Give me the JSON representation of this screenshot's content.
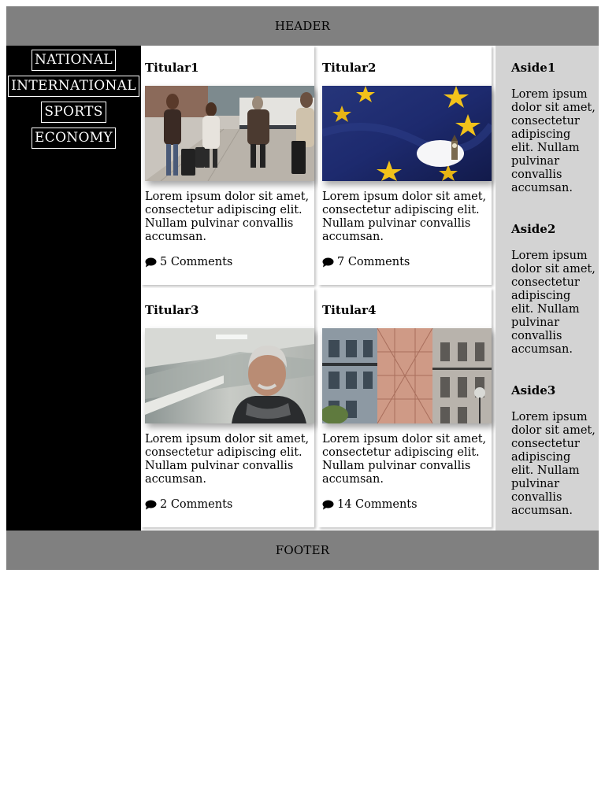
{
  "header": {
    "label": "HEADER"
  },
  "footer": {
    "label": "FOOTER"
  },
  "nav": {
    "items": [
      {
        "label": "NATIONAL"
      },
      {
        "label": "INTERNATIONAL"
      },
      {
        "label": "SPORTS"
      },
      {
        "label": "ECONOMY"
      }
    ]
  },
  "articles": [
    {
      "title": "Titular1",
      "text": "Lorem ipsum dolor sit amet, consectetur adipiscing elit. Nullam pulvinar convallis accumsan.",
      "comments": "5 Comments"
    },
    {
      "title": "Titular2",
      "text": "Lorem ipsum dolor sit amet, consectetur adipiscing elit. Nullam pulvinar convallis accumsan.",
      "comments": "7 Comments"
    },
    {
      "title": "Titular3",
      "text": "Lorem ipsum dolor sit amet, consectetur adipiscing elit. Nullam pulvinar convallis accumsan.",
      "comments": "2 Comments"
    },
    {
      "title": "Titular4",
      "text": "Lorem ipsum dolor sit amet, consectetur adipiscing elit. Nullam pulvinar convallis accumsan.",
      "comments": "14 Comments"
    }
  ],
  "aside": [
    {
      "title": "Aside1",
      "text": "Lorem ipsum dolor sit amet, consectetur adipiscing elit. Nullam pulvinar convallis accumsan."
    },
    {
      "title": "Aside2",
      "text": "Lorem ipsum dolor sit amet, consectetur adipiscing elit. Nullam pulvinar convallis accumsan."
    },
    {
      "title": "Aside3",
      "text": "Lorem ipsum dolor sit amet, consectetur adipiscing elit. Nullam pulvinar convallis accumsan."
    }
  ],
  "icons": {
    "comment": "comment-bubble-icon"
  },
  "colors": {
    "header_bg": "#808080",
    "nav_bg": "#000000",
    "aside_bg": "#d3d3d3"
  }
}
